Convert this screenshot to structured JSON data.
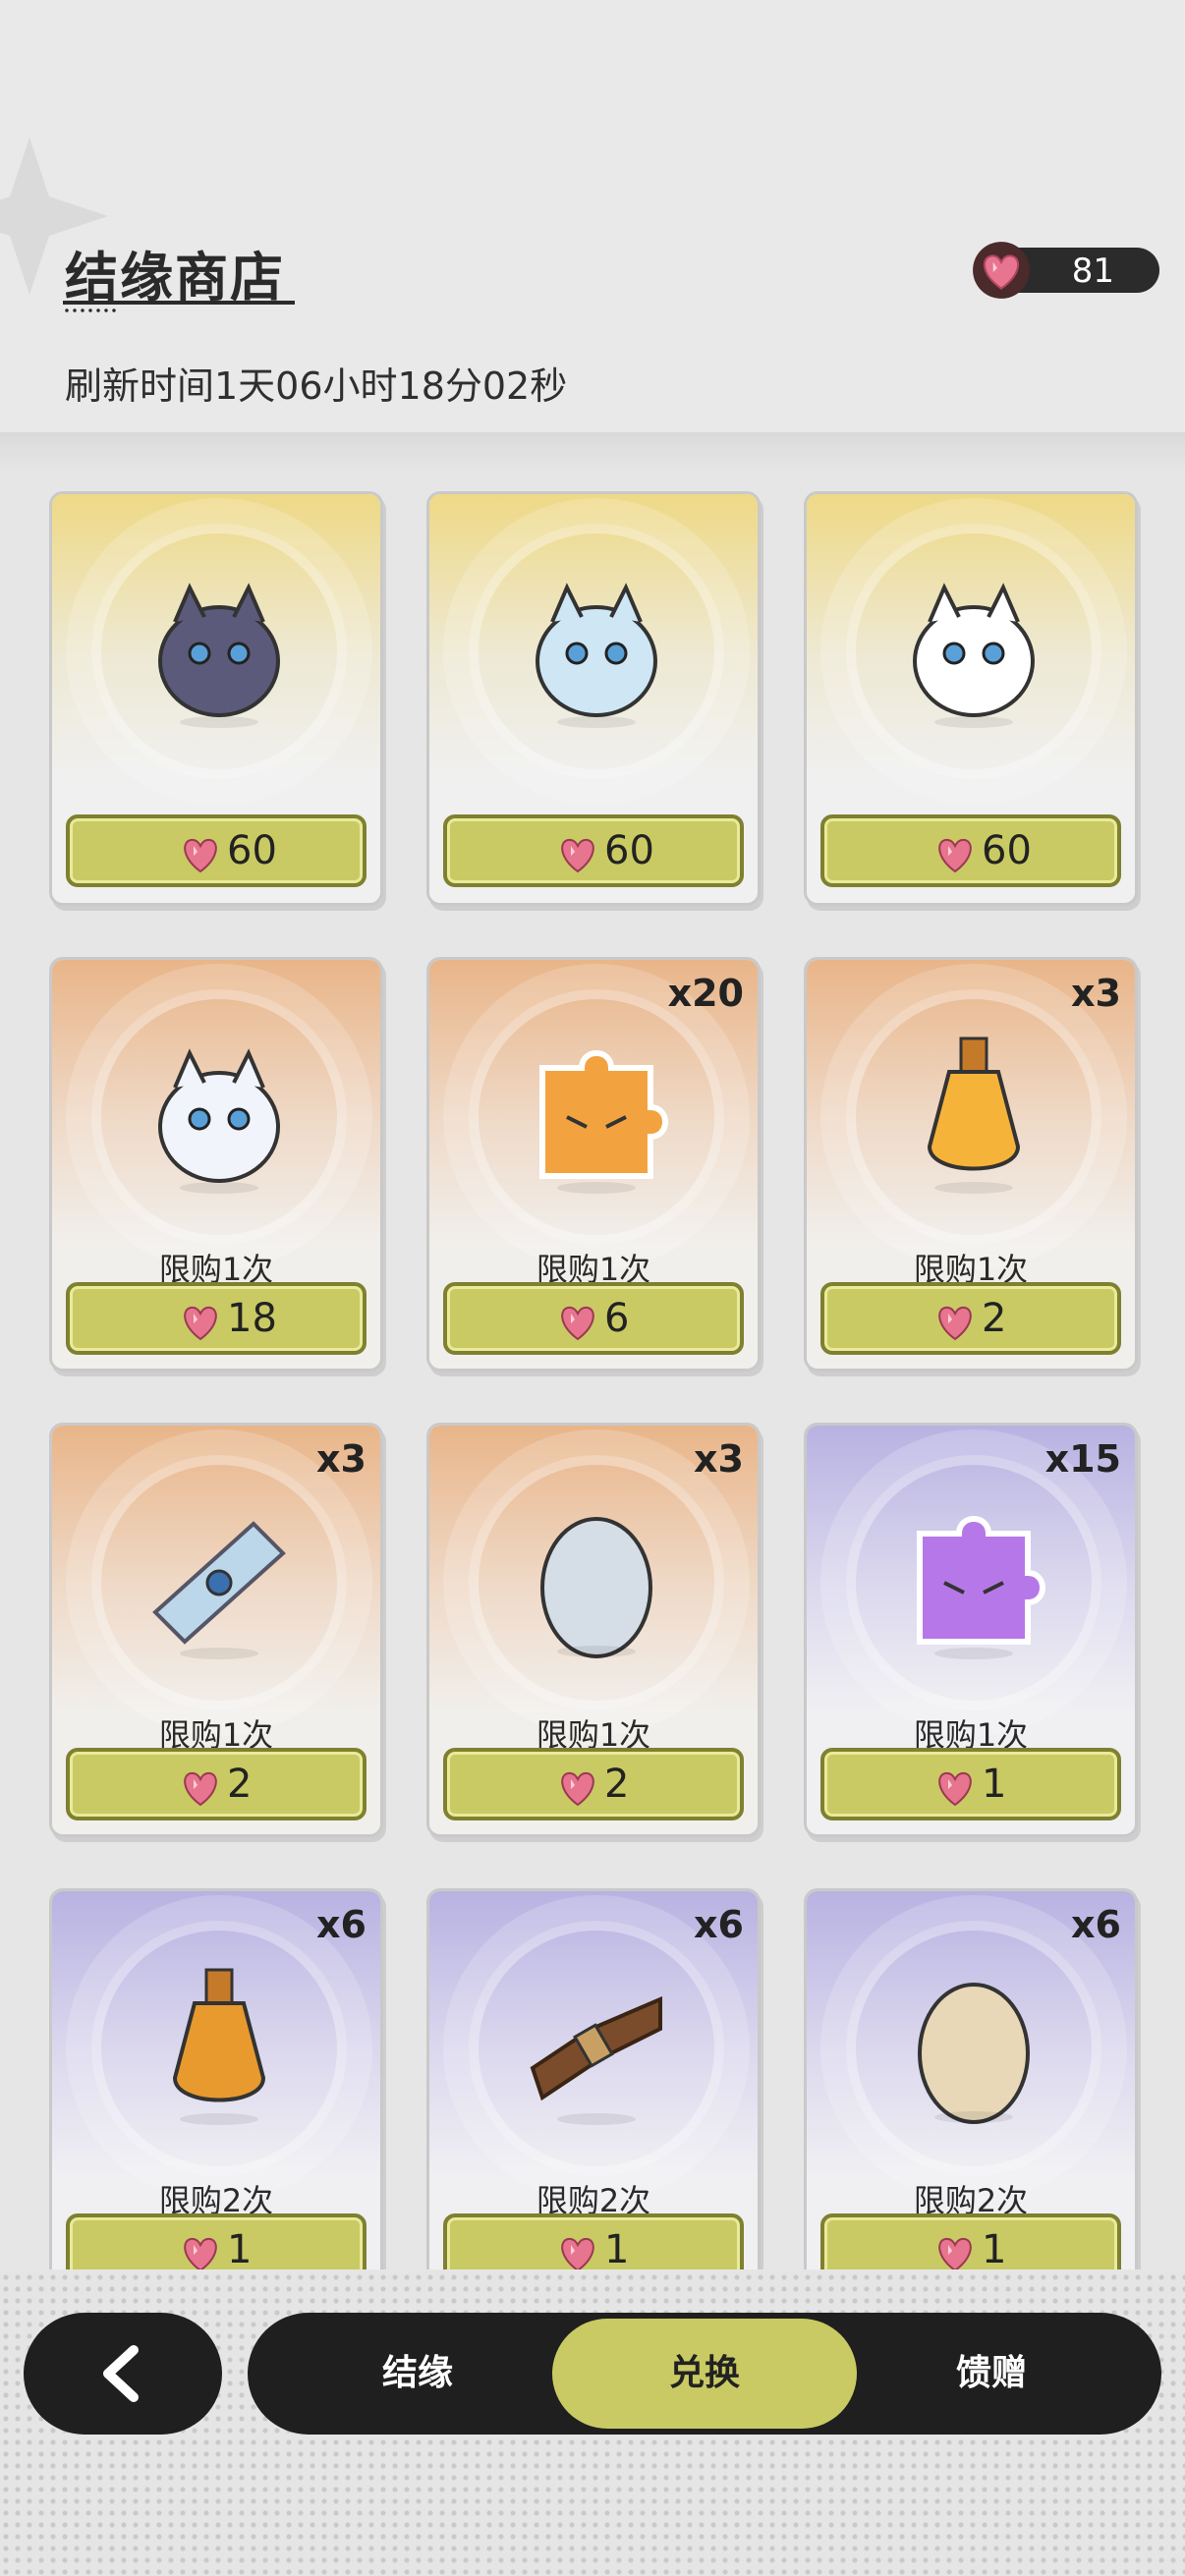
{
  "header": {
    "title": "结缘商店",
    "refresh_text": "刷新时间1天06小时18分02秒",
    "currency_icon": "heart-gem-icon",
    "currency_value": "81"
  },
  "colors": {
    "accent": "#c9ca63",
    "dark": "#1f1f1f",
    "gold_card": "#eed986",
    "orange_card": "#e9b589",
    "purple_card": "#b8b2e2"
  },
  "items": [
    {
      "icon": "dark-cat-pet-icon",
      "qty": "",
      "limit": "",
      "price": "60",
      "tier": "gold"
    },
    {
      "icon": "winged-white-pet-icon",
      "qty": "",
      "limit": "",
      "price": "60",
      "tier": "gold"
    },
    {
      "icon": "panda-pet-icon",
      "qty": "",
      "limit": "",
      "price": "60",
      "tier": "gold"
    },
    {
      "icon": "ghost-unicorn-pet-icon",
      "qty": "",
      "limit": "限购1次",
      "price": "18",
      "tier": "orange"
    },
    {
      "icon": "orange-tiger-puzzle-icon",
      "qty": "x20",
      "limit": "限购1次",
      "price": "6",
      "tier": "orange"
    },
    {
      "icon": "orange-potion-bottle-icon",
      "qty": "x3",
      "limit": "限购1次",
      "price": "2",
      "tier": "orange"
    },
    {
      "icon": "blue-scroll-icon",
      "qty": "x3",
      "limit": "限购1次",
      "price": "2",
      "tier": "orange"
    },
    {
      "icon": "silver-egg-icon",
      "qty": "x3",
      "limit": "限购1次",
      "price": "2",
      "tier": "orange"
    },
    {
      "icon": "purple-tiger-puzzle-icon",
      "qty": "x15",
      "limit": "限购1次",
      "price": "1",
      "tier": "purple"
    },
    {
      "icon": "amber-potion-icon",
      "qty": "x6",
      "limit": "限购2次",
      "price": "1",
      "tier": "purple"
    },
    {
      "icon": "rope-bundle-icon",
      "qty": "x6",
      "limit": "限购2次",
      "price": "1",
      "tier": "purple"
    },
    {
      "icon": "plain-egg-icon",
      "qty": "x6",
      "limit": "限购2次",
      "price": "1",
      "tier": "purple"
    }
  ],
  "nav": {
    "back_icon": "back-chevron-icon",
    "tabs": [
      {
        "label": "结缘",
        "active": false
      },
      {
        "label": "兑换",
        "active": true
      },
      {
        "label": "馈赠",
        "active": false
      }
    ]
  }
}
